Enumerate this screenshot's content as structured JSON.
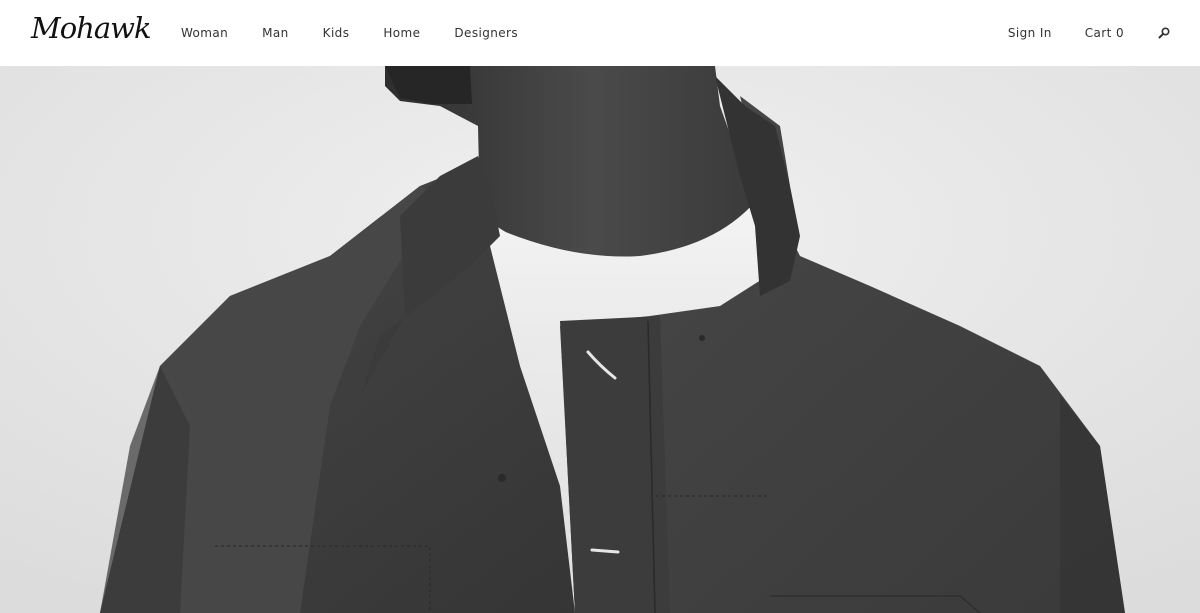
{
  "brand": {
    "logo_text": "Mohawk"
  },
  "nav": {
    "items": [
      {
        "label": "Woman"
      },
      {
        "label": "Man"
      },
      {
        "label": "Kids"
      },
      {
        "label": "Home"
      },
      {
        "label": "Designers"
      }
    ]
  },
  "account": {
    "sign_in_label": "Sign In",
    "cart_label": "Cart 0",
    "search_icon": "search-icon"
  },
  "hero": {
    "image_subject": "black and white photo of a man wearing a dark work jacket over a white t-shirt"
  },
  "colors": {
    "header_bg": "#ffffff",
    "text": "#333333",
    "logo": "#111111"
  }
}
